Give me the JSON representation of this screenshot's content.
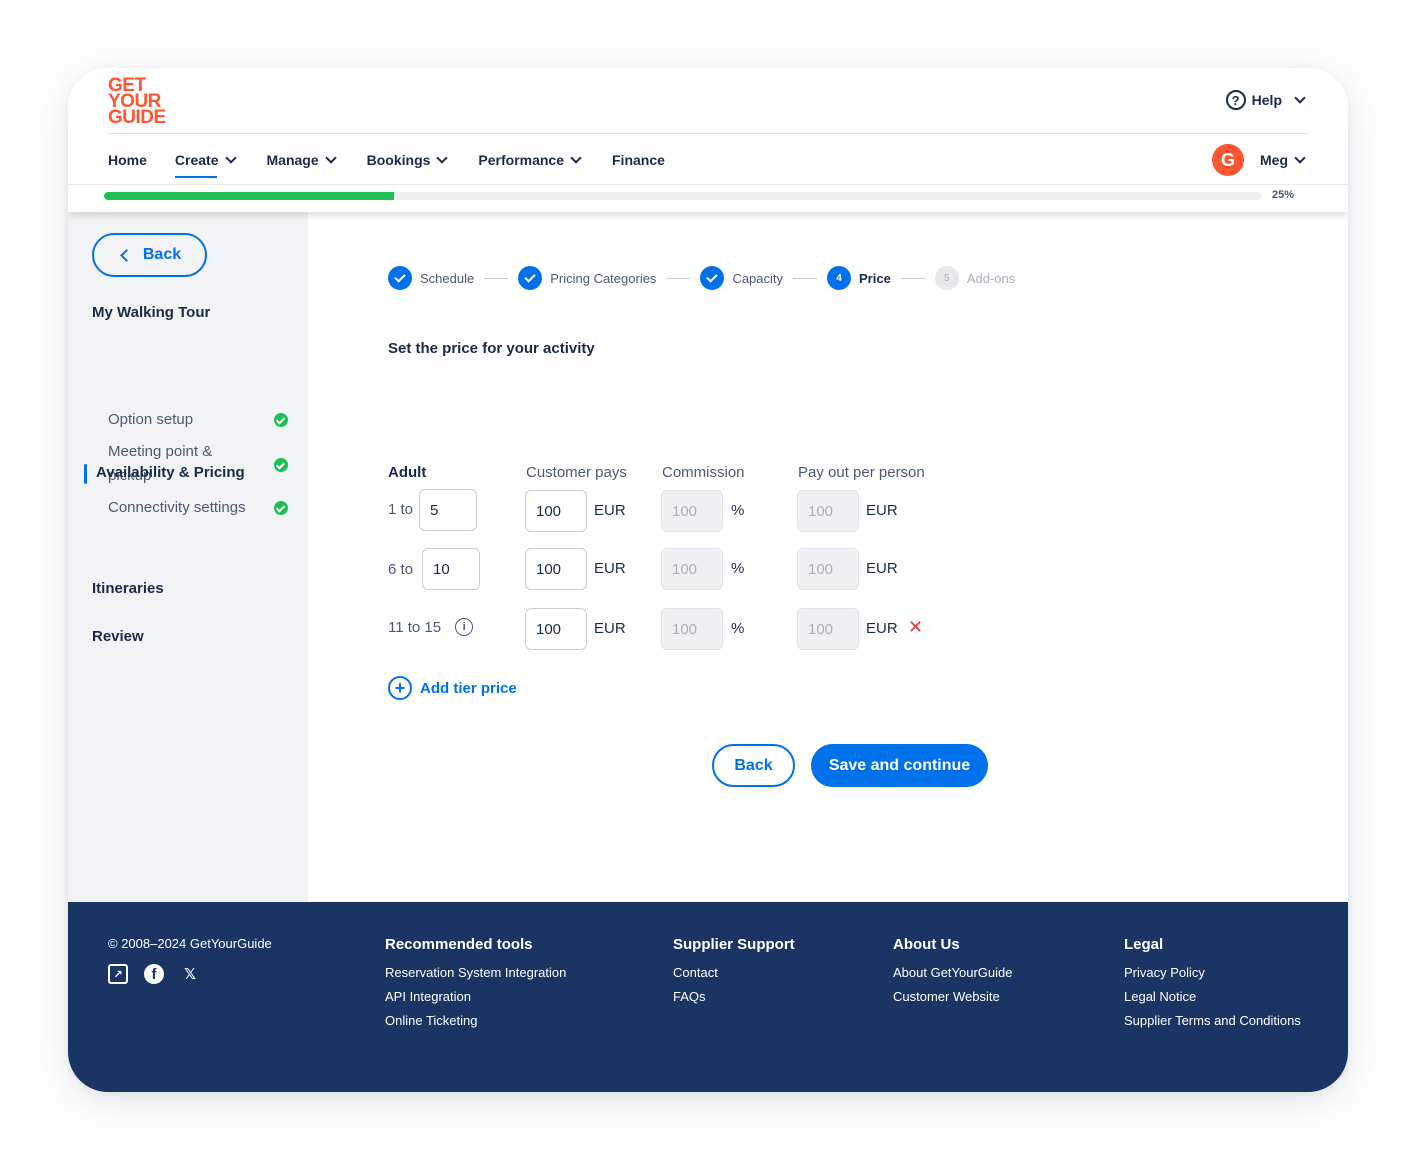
{
  "brand": {
    "logo_lines": [
      "GET",
      "YOUR",
      "GUIDE"
    ],
    "accent": "#ff5533",
    "primary": "#0071eb"
  },
  "header": {
    "help_label": "Help",
    "nav": [
      "Home",
      "Create",
      "Manage",
      "Bookings",
      "Performance",
      "Finance"
    ],
    "user_initial": "G",
    "user_name": "Meg",
    "progress_label": "25%",
    "progress_fraction": 0.25
  },
  "sidebar": {
    "back_label": "Back",
    "tour_title": "My Walking Tour",
    "items": [
      "Option setup",
      "Meeting point & pickup",
      "Connectivity settings"
    ],
    "active_item": "Availability & Pricing",
    "sections": [
      "Itineraries",
      "Review"
    ]
  },
  "stepper": {
    "steps": [
      {
        "num": "1",
        "label": "Schedule",
        "state": "done"
      },
      {
        "num": "2",
        "label": "Pricing Categories",
        "state": "done"
      },
      {
        "num": "3",
        "label": "Capacity",
        "state": "done"
      },
      {
        "num": "4",
        "label": "Price",
        "state": "current"
      },
      {
        "num": "5",
        "label": "Add-ons",
        "state": "future"
      }
    ]
  },
  "main": {
    "section_title": "Set the price for your activity",
    "category": "Adult",
    "headers": {
      "customer_pays": "Customer pays",
      "commission": "Commission",
      "payout": "Pay out per person"
    },
    "currency": "EUR",
    "percent": "%",
    "tiers": [
      {
        "label": "1 to",
        "to_value": "5",
        "customer_pays": "100",
        "commission": "100",
        "payout": "100"
      },
      {
        "label": "6 to",
        "to_value": "10",
        "customer_pays": "100",
        "commission": "100",
        "payout": "100"
      },
      {
        "label": "11 to 15",
        "customer_pays": "100",
        "commission": "100",
        "payout": "100"
      }
    ],
    "add_tier_label": "Add tier price",
    "back_button": "Back",
    "save_button": "Save and continue"
  },
  "footer": {
    "copyright": "© 2008–2024 GetYourGuide",
    "columns": [
      {
        "title": "Recommended tools",
        "links": [
          "Reservation System Integration",
          "API Integration",
          "Online Ticketing"
        ]
      },
      {
        "title": "Supplier Support",
        "links": [
          "Contact",
          "FAQs"
        ]
      },
      {
        "title": "About Us",
        "links": [
          "About GetYourGuide",
          "Customer Website"
        ]
      },
      {
        "title": "Legal",
        "links": [
          "Privacy Policy",
          "Legal Notice",
          "Supplier Terms and Conditions"
        ]
      }
    ]
  }
}
